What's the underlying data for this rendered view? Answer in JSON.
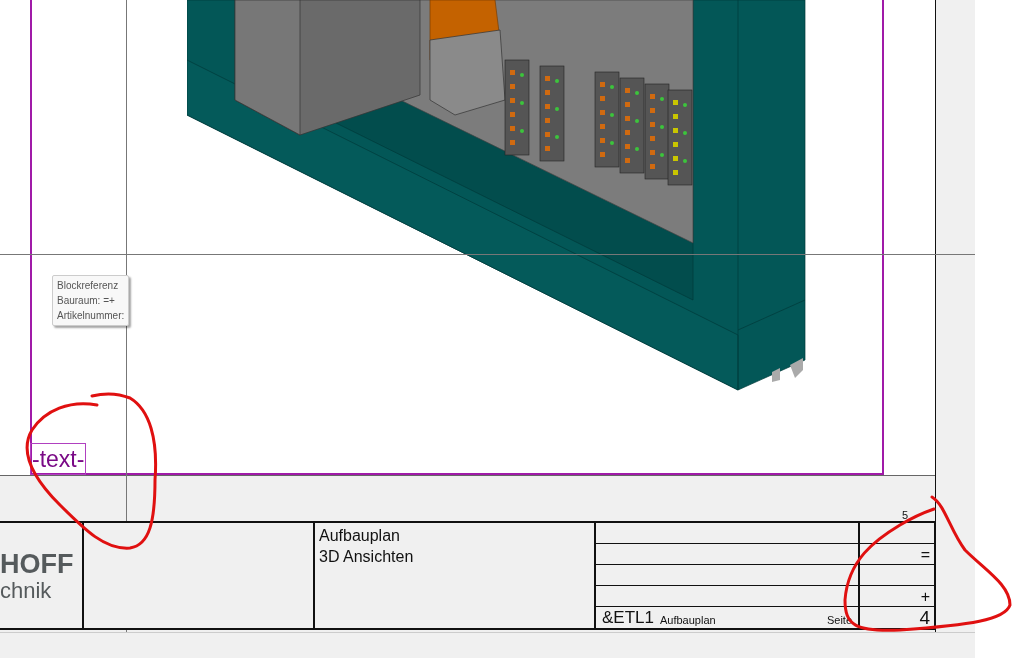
{
  "tooltip": {
    "lines": [
      "Blockreferenz",
      "Bauraum: =+",
      "Artikelnummer:"
    ]
  },
  "placeholder_text": "-text-",
  "column_number": "5",
  "title_block": {
    "logo": {
      "line_1": "HOFF",
      "line_2": "chnik"
    },
    "title_lines": [
      "Aufbauplan",
      "3D Ansichten"
    ],
    "function_field": "=",
    "location_field": "+",
    "document_code": "&ETL1",
    "document_type": "Aufbauplan",
    "page_label": "Seite",
    "page_number": "4"
  }
}
